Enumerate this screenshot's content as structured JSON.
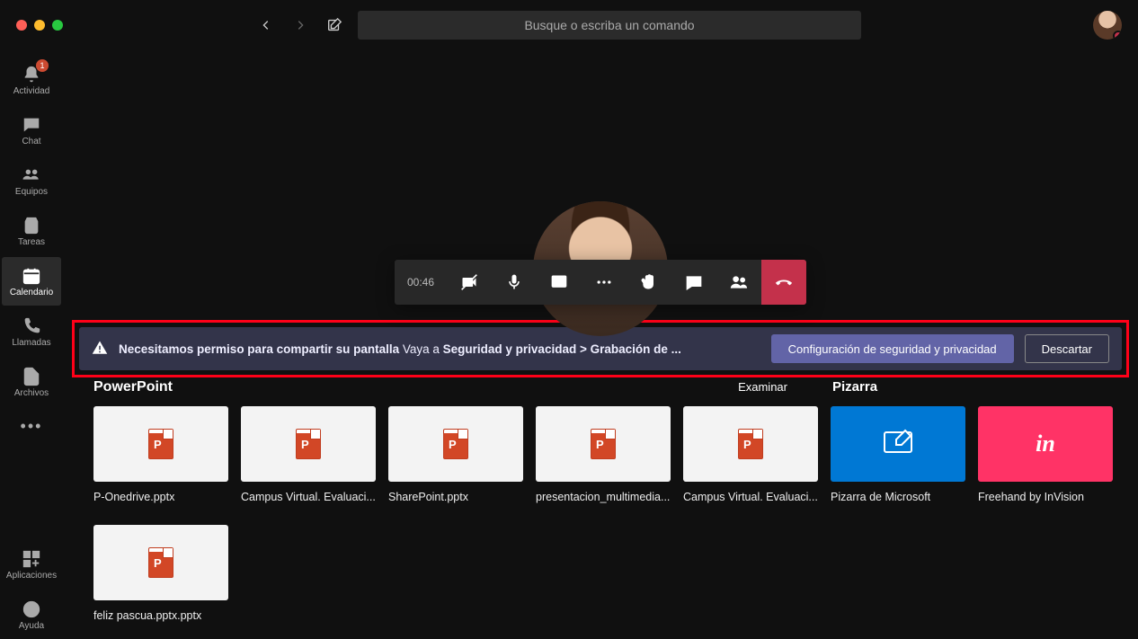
{
  "titlebar": {
    "search_placeholder": "Busque o escriba un comando"
  },
  "sidebar": {
    "items": [
      {
        "label": "Actividad",
        "badge": "1"
      },
      {
        "label": "Chat"
      },
      {
        "label": "Equipos"
      },
      {
        "label": "Tareas"
      },
      {
        "label": "Calendario"
      },
      {
        "label": "Llamadas"
      },
      {
        "label": "Archivos"
      }
    ],
    "more": "•••",
    "apps_label": "Aplicaciones",
    "help_label": "Ayuda"
  },
  "call": {
    "duration": "00:46"
  },
  "permission": {
    "bold1": "Necesitamos permiso para compartir su pantalla",
    "text1": " Vaya a ",
    "bold2": "Seguridad y privacidad > Grabación de ...",
    "primary_btn": "Configuración de seguridad y privacidad",
    "secondary_btn": "Descartar"
  },
  "share": {
    "powerpoint_header": "PowerPoint",
    "examinar": "Examinar",
    "pizarra_header": "Pizarra",
    "files": [
      "P-Onedrive.pptx",
      "Campus Virtual. Evaluaci...",
      "SharePoint.pptx",
      "presentacion_multimedia...",
      "Campus Virtual. Evaluaci..."
    ],
    "whiteboard": "Pizarra de Microsoft",
    "invision": "Freehand by InVision",
    "files_row2": [
      "feliz pascua.pptx.pptx"
    ]
  }
}
